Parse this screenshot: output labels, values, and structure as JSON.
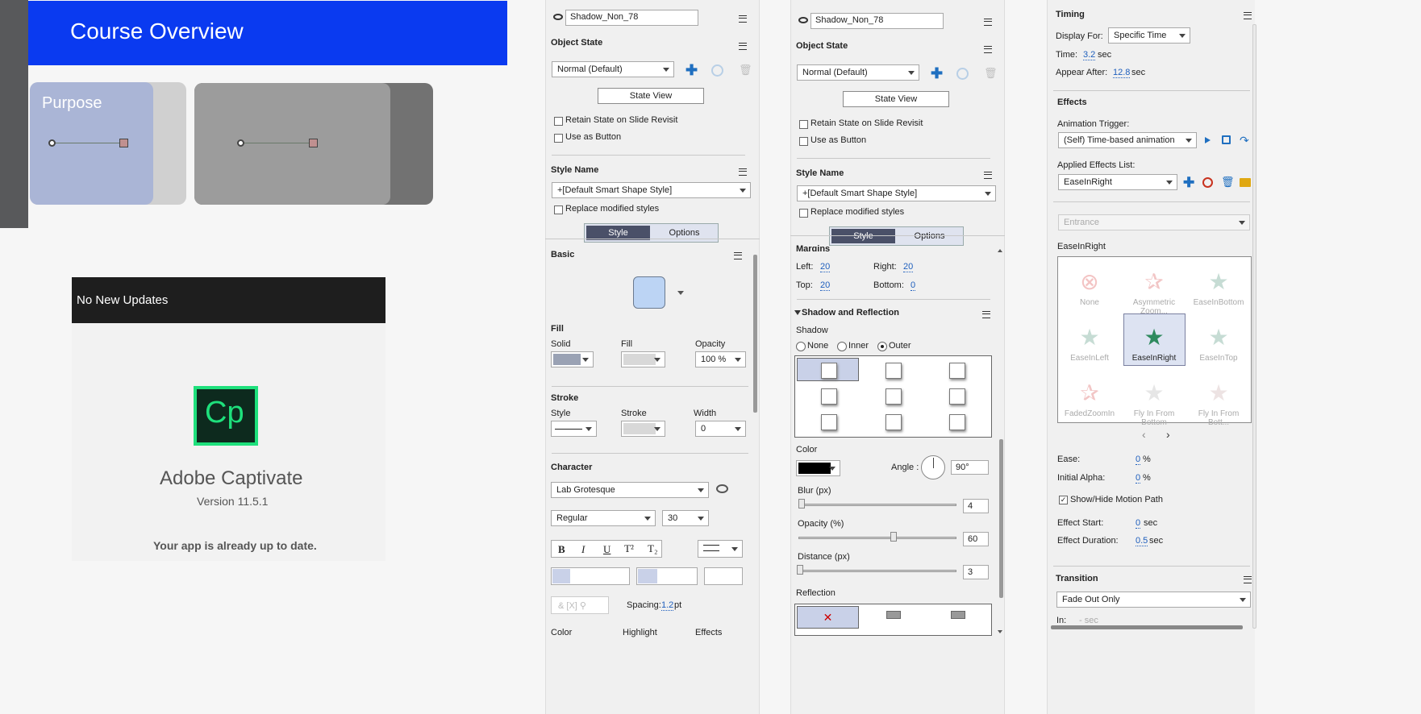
{
  "slide": {
    "title": "Course Overview",
    "purpose": "Purpose"
  },
  "about": {
    "header": "No New Updates",
    "logo": "Cp",
    "app_name": "Adobe Captivate",
    "version": "Version 11.5.1",
    "status": "Your app is already up to date."
  },
  "props1": {
    "name": "Shadow_Non_78",
    "object_state": "Object State",
    "state_value": "Normal (Default)",
    "state_view": "State View",
    "retain": "Retain State on Slide Revisit",
    "use_button": "Use as Button",
    "style_name": "Style Name",
    "style_value": "+[Default Smart Shape Style]",
    "replace": "Replace modified styles",
    "tabs": [
      "Style",
      "Options"
    ],
    "basic": "Basic",
    "fill": "Fill",
    "fill_cols": [
      "Solid",
      "Fill",
      "Opacity"
    ],
    "opacity": "100 %",
    "stroke": "Stroke",
    "stroke_cols": [
      "Style",
      "Stroke",
      "Width"
    ],
    "width": "0",
    "character": "Character",
    "font": "Lab Grotesque",
    "font_style": "Regular",
    "font_size": "30",
    "format_btns": [
      "B",
      "I",
      "U",
      "T²",
      "T₂"
    ],
    "spacing_label": "Spacing:",
    "spacing": "1.2",
    "spacing_unit": "pt",
    "bottom_cols": [
      "Color",
      "Highlight",
      "Effects"
    ]
  },
  "props2": {
    "name": "Shadow_Non_78",
    "object_state": "Object State",
    "state_value": "Normal (Default)",
    "state_view": "State View",
    "retain": "Retain State on Slide Revisit",
    "use_button": "Use as Button",
    "style_name": "Style Name",
    "style_value": "+[Default Smart Shape Style]",
    "replace": "Replace modified styles",
    "tabs": [
      "Style",
      "Options"
    ],
    "margins": "Margins",
    "left_l": "Left:",
    "left": "20",
    "right_l": "Right:",
    "right": "20",
    "top_l": "Top:",
    "top": "20",
    "bottom_l": "Bottom:",
    "bottom": "0",
    "shadow_section": "Shadow and Reflection",
    "shadow": "Shadow",
    "shadow_opts": [
      "None",
      "Inner",
      "Outer"
    ],
    "color": "Color",
    "angle_l": "Angle :",
    "angle": "90°",
    "blur_l": "Blur (px)",
    "blur": "4",
    "blur_level": 0.03,
    "opacity_l": "Opacity (%)",
    "opacity": "60",
    "opacity_level": 0.6,
    "distance_l": "Distance (px)",
    "distance": "3",
    "distance_level": 0.0,
    "reflection": "Reflection"
  },
  "timing": {
    "title": "Timing",
    "display_for_l": "Display For:",
    "display_for": "Specific Time",
    "time_l": "Time:",
    "time": "3.2",
    "time_unit": "sec",
    "appear_l": "Appear After:",
    "appear": "12.8",
    "appear_unit": "sec",
    "effects": "Effects",
    "trigger_l": "Animation Trigger:",
    "trigger": "(Self) Time-based animation",
    "applied_l": "Applied Effects List:",
    "applied": "EaseInRight",
    "category": "Entrance",
    "selected": "EaseInRight",
    "effects_list": [
      "None",
      "Asymmetric Zoom...",
      "EaseInBottom",
      "EaseInLeft",
      "EaseInRight",
      "EaseInTop",
      "FadedZoomIn",
      "Fly In From Bottom",
      "Fly In From Bott..."
    ],
    "ease_l": "Ease:",
    "ease": "0",
    "ease_unit": "%",
    "alpha_l": "Initial Alpha:",
    "alpha": "0",
    "alpha_unit": "%",
    "motion_path": "Show/Hide Motion Path",
    "start_l": "Effect Start:",
    "start": "0",
    "start_unit": "sec",
    "duration_l": "Effect Duration:",
    "duration": "0.5",
    "duration_unit": "sec",
    "transition": "Transition",
    "transition_value": "Fade Out Only",
    "in_l": "In:",
    "in_value": "- sec"
  }
}
